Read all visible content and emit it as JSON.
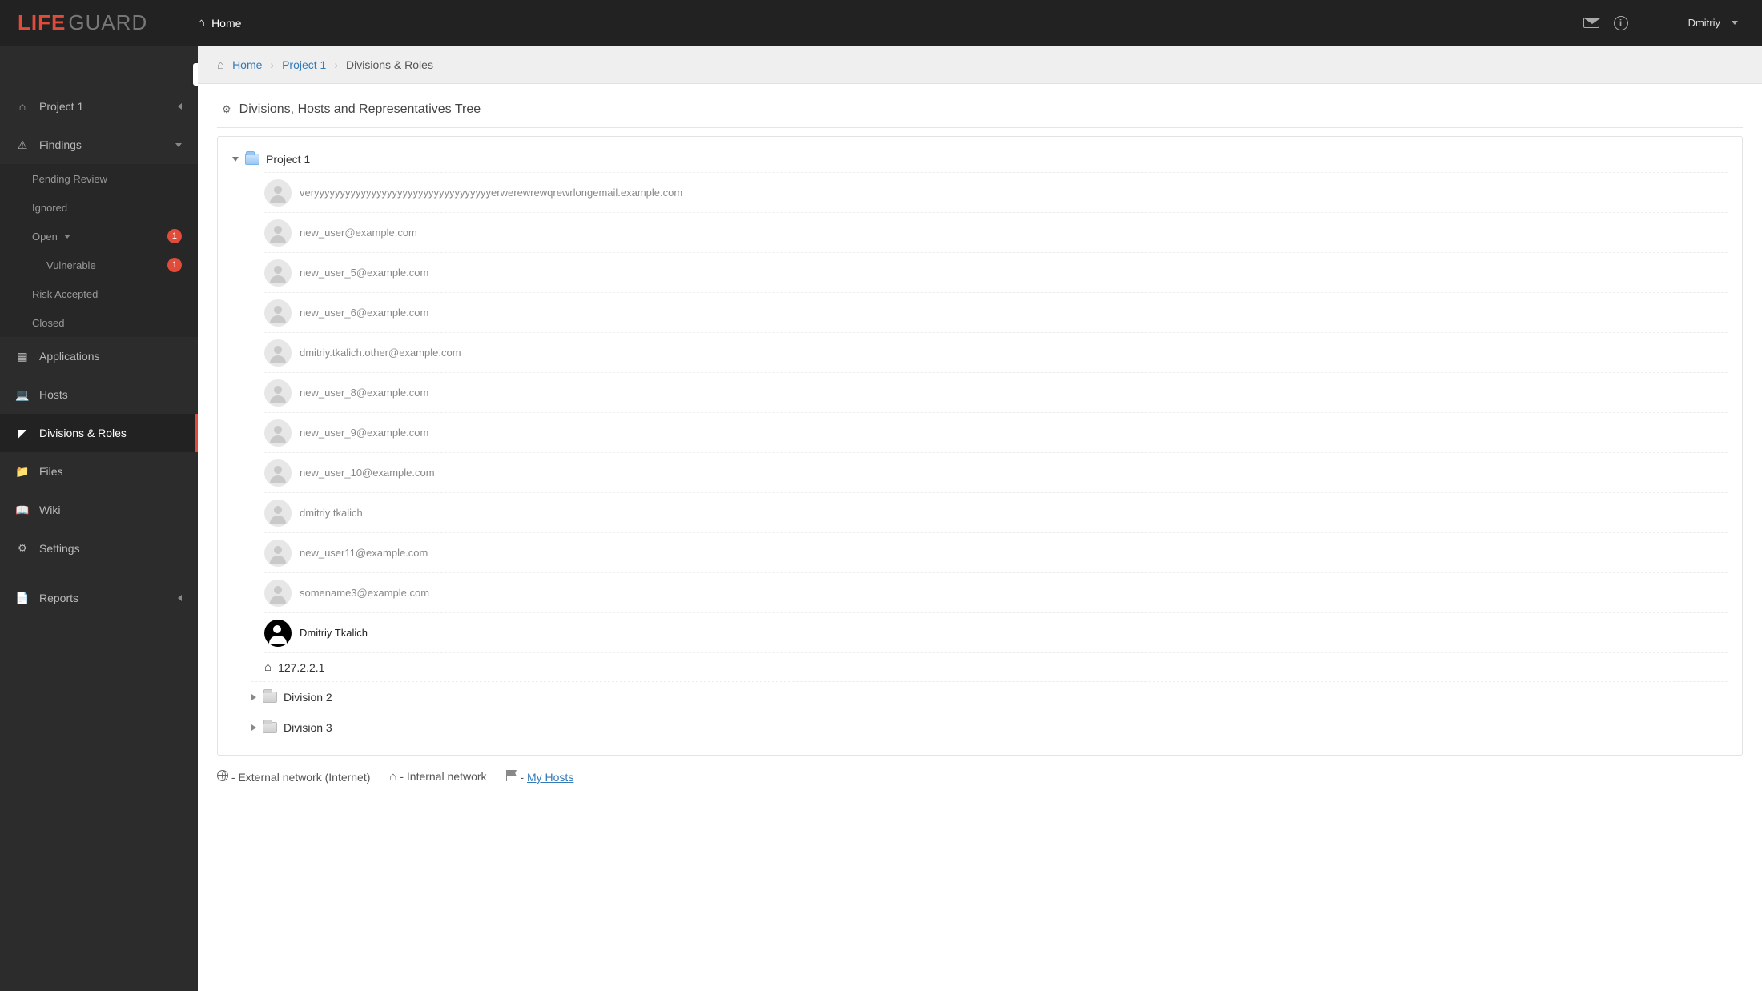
{
  "brand": {
    "part1": "LIFE",
    "part2": "GUARD"
  },
  "topnav": {
    "home": "Home"
  },
  "user": {
    "name": "Dmitriy"
  },
  "sidebar": {
    "project": {
      "label": "Project 1"
    },
    "findings": {
      "label": "Findings",
      "children": {
        "pending": "Pending Review",
        "ignored": "Ignored",
        "open": {
          "label": "Open",
          "badge": "1",
          "children": {
            "vulnerable": {
              "label": "Vulnerable",
              "badge": "1"
            }
          }
        },
        "risk_accepted": "Risk Accepted",
        "closed": "Closed"
      }
    },
    "applications": "Applications",
    "hosts": "Hosts",
    "divisions": "Divisions & Roles",
    "files": "Files",
    "wiki": "Wiki",
    "settings": "Settings",
    "reports": "Reports"
  },
  "breadcrumb": {
    "home": "Home",
    "project": "Project 1",
    "current": "Divisions & Roles"
  },
  "panel": {
    "title": "Divisions, Hosts and Representatives Tree",
    "root": "Project 1",
    "users": [
      "veryyyyyyyyyyyyyyyyyyyyyyyyyyyyyyyyyyerwerewrewqrewrlongemail.example.com",
      "new_user@example.com",
      "new_user_5@example.com",
      "new_user_6@example.com",
      "dmitriy.tkalich.other@example.com",
      "new_user_8@example.com",
      "new_user_9@example.com",
      "new_user_10@example.com",
      "dmitriy tkalich",
      "new_user11@example.com",
      "somename3@example.com"
    ],
    "self_user": "Dmitriy Tkalich",
    "host": "127.2.2.1",
    "subdivisions": [
      "Division 2",
      "Division 3"
    ]
  },
  "legend": {
    "external": " - External network (Internet)",
    "internal": " - Internal network",
    "myhosts_sep": " - ",
    "myhosts": "My Hosts"
  }
}
